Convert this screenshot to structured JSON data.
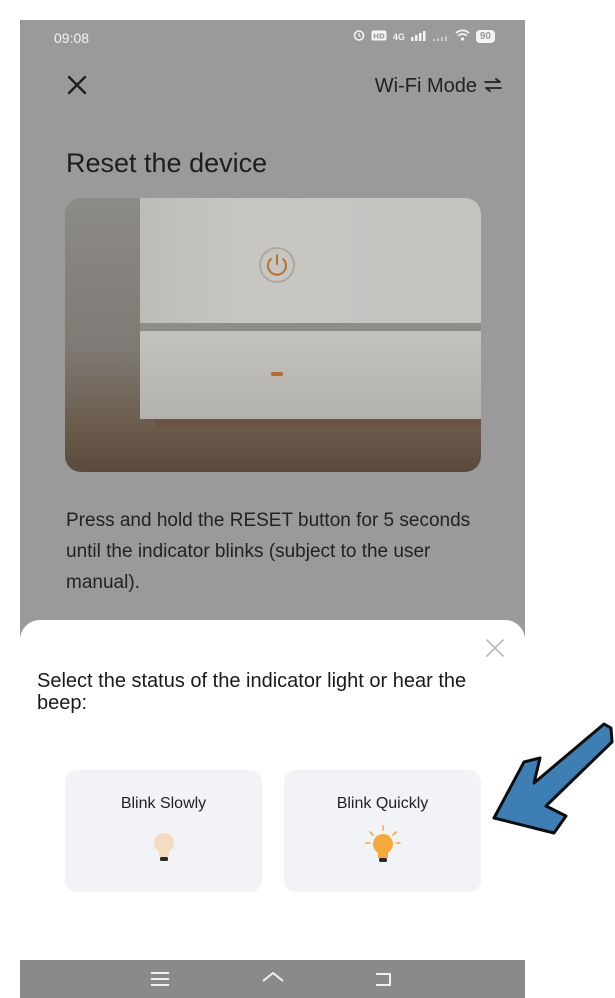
{
  "status_bar": {
    "time": "09:08",
    "network": "4G",
    "battery": "90"
  },
  "header": {
    "mode_label": "Wi-Fi Mode"
  },
  "page_title": "Reset the device",
  "instructions": "Press and hold the RESET button for 5 seconds until the indicator blinks (subject to the user manual).",
  "sheet": {
    "title": "Select the status of the indicator light or hear the beep:",
    "options": [
      {
        "label": "Blink Slowly",
        "icon": "bulb-dim-icon"
      },
      {
        "label": "Blink Quickly",
        "icon": "bulb-bright-icon"
      }
    ]
  },
  "colors": {
    "overlay": "#9a9a9a",
    "option_bg": "#f2f3f6",
    "bulb_quick": "#f6a93b",
    "bulb_slow": "#f4dcc0",
    "arrow": "#3d7fb5"
  },
  "icons": {
    "close": "close-icon",
    "swap": "swap-arrows-icon",
    "nav": [
      "menu-icon",
      "home-icon",
      "back-icon"
    ]
  }
}
